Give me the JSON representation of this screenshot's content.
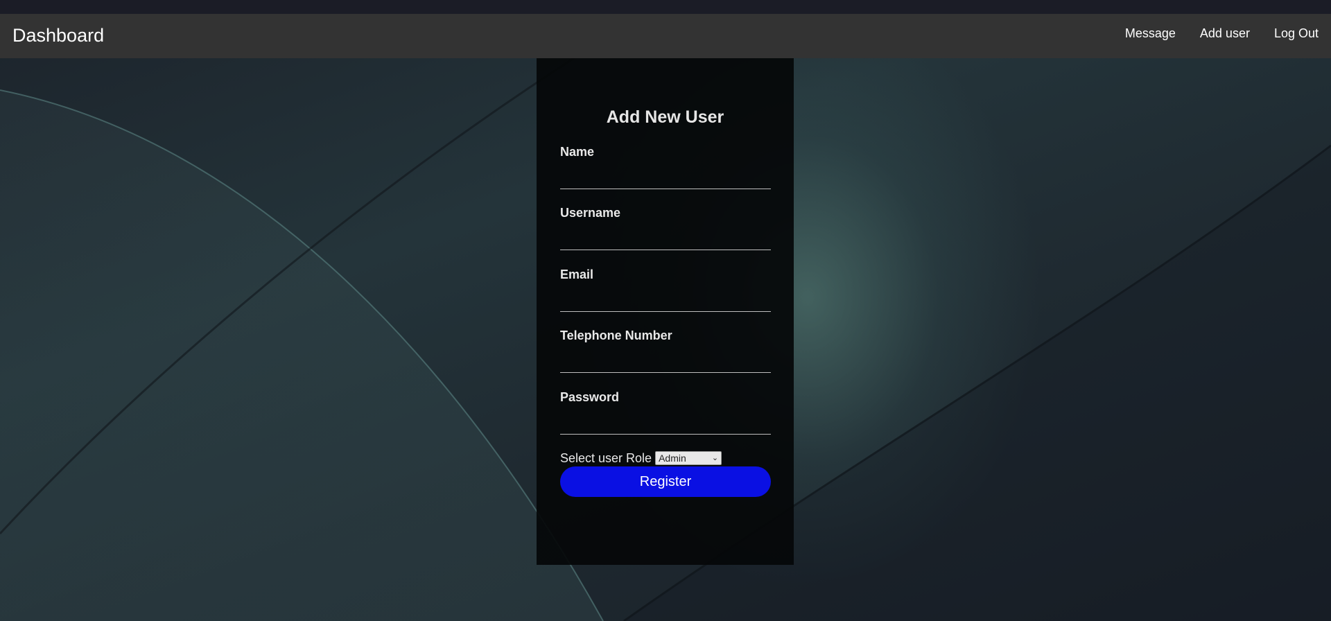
{
  "navbar": {
    "brand": "Dashboard",
    "links": [
      {
        "label": "Message"
      },
      {
        "label": "Add user"
      },
      {
        "label": "Log Out"
      }
    ]
  },
  "form": {
    "title": "Add New User",
    "fields": [
      {
        "label": "Name",
        "value": ""
      },
      {
        "label": "Username",
        "value": ""
      },
      {
        "label": "Email",
        "value": ""
      },
      {
        "label": "Telephone Number",
        "value": ""
      },
      {
        "label": "Password",
        "value": ""
      }
    ],
    "role_label": "Select user Role",
    "role_selected": "Admin",
    "submit_label": "Register"
  },
  "colors": {
    "navbar_bg": "#333333",
    "button_bg": "#0a10e3",
    "panel_bg": "#050809"
  }
}
